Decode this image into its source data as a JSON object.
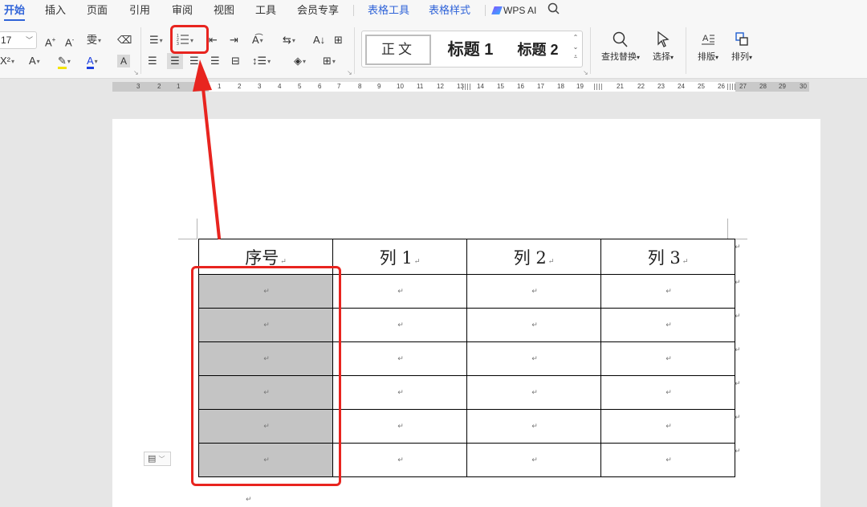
{
  "menu": {
    "tabs": [
      "开始",
      "插入",
      "页面",
      "引用",
      "审阅",
      "视图",
      "工具",
      "会员专享"
    ],
    "context_tabs": [
      "表格工具",
      "表格样式"
    ],
    "ai_label": "WPS AI"
  },
  "ribbon": {
    "font_size": "17",
    "styles": {
      "normal": "正文",
      "h1": "标题 1",
      "h2": "标题 2"
    },
    "find_replace": "查找替换",
    "select": "选择",
    "layout": "排版",
    "arrange": "排列"
  },
  "ruler": {
    "ticks": [
      "3",
      "2",
      "1",
      "1",
      "2",
      "3",
      "4",
      "5",
      "6",
      "7",
      "8",
      "9",
      "10",
      "11",
      "12",
      "13",
      "14",
      "15",
      "16",
      "17",
      "18",
      "19",
      "21",
      "22",
      "23",
      "24",
      "25",
      "26",
      "27",
      "28",
      "29",
      "30"
    ]
  },
  "table": {
    "header": [
      "序号",
      "列 1",
      "列 2",
      "列 3"
    ],
    "body_rows": 6,
    "paragraph_mark": "↵"
  },
  "colors": {
    "accent": "#2f63d8",
    "annotation": "#e8241f",
    "selection": "#c4c4c4"
  },
  "icons": [
    "search-icon",
    "numbered-list-icon",
    "bullet-list-icon",
    "eraser-icon",
    "cursor-select-icon",
    "table-handle-icon"
  ]
}
